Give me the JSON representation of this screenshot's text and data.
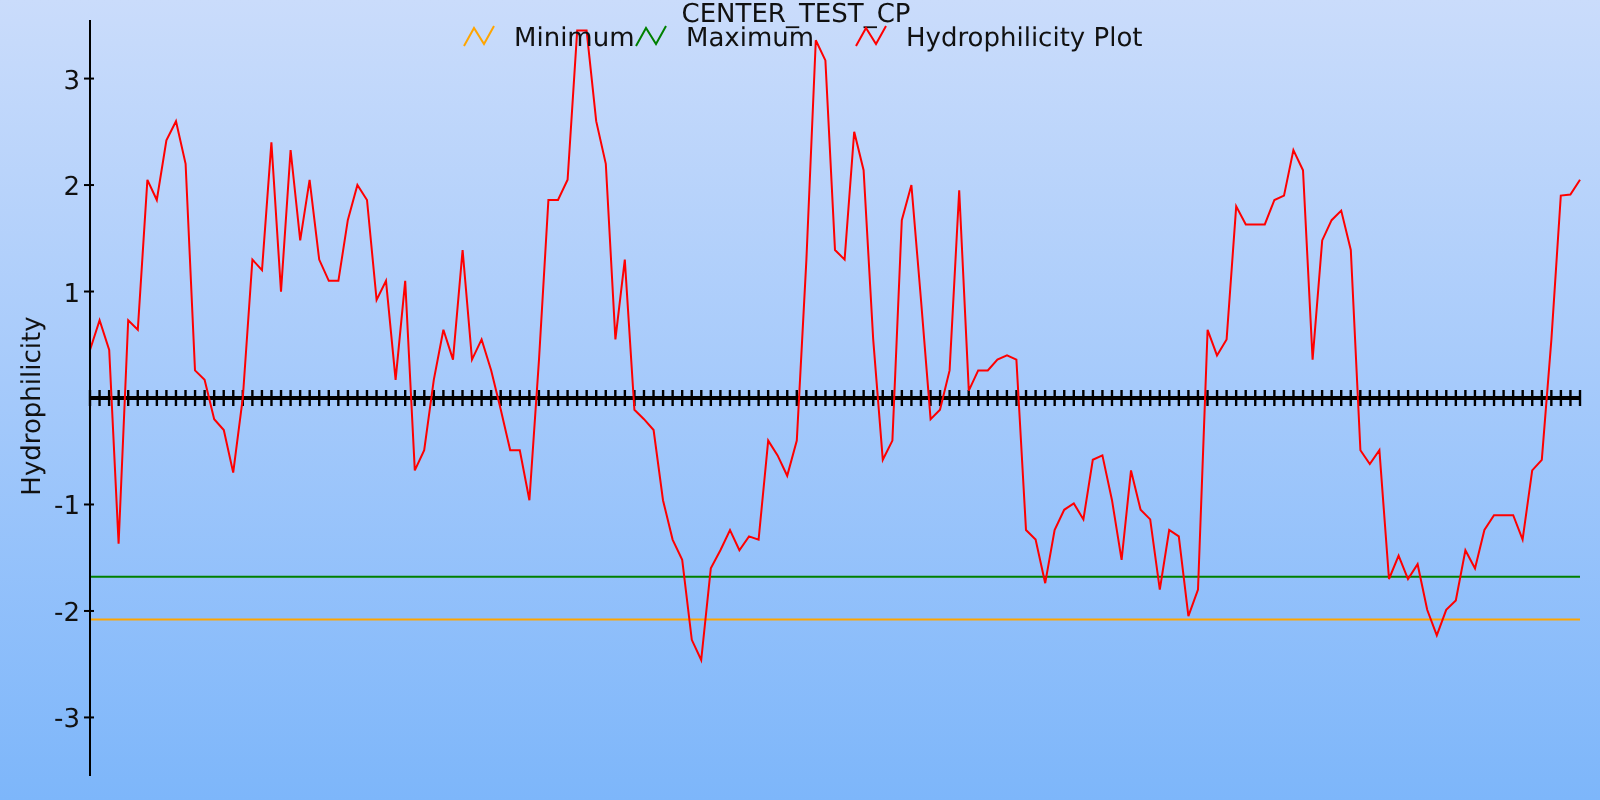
{
  "chart_data": {
    "type": "line",
    "title": "CENTER_TEST_CP",
    "ylabel": "Hydrophilicity",
    "legend": "top",
    "ylim": [
      -3.55,
      3.55
    ],
    "yticks": [
      -3,
      -2,
      -1,
      1,
      2,
      3
    ],
    "categories": [
      null,
      null,
      null,
      null,
      null,
      null,
      null,
      null,
      null,
      null,
      null,
      null,
      null,
      null,
      null,
      null,
      null,
      null,
      null,
      null,
      null,
      null,
      null,
      null,
      null,
      null,
      null,
      null,
      null,
      null,
      null,
      null,
      null,
      null,
      null,
      null,
      null,
      null,
      null,
      null,
      null,
      null,
      null,
      null,
      null,
      null,
      null,
      null,
      null,
      null,
      null,
      null,
      null,
      null,
      null,
      null,
      null,
      null,
      null,
      null,
      null,
      null,
      null,
      null,
      null,
      null,
      null,
      null,
      null,
      null,
      null,
      null,
      null,
      null,
      null,
      null,
      null,
      null,
      null,
      null,
      null,
      null,
      null,
      null,
      null,
      null,
      null,
      null,
      null,
      null,
      null,
      null,
      null,
      null,
      null,
      null,
      null,
      null,
      null,
      null,
      null,
      null,
      null,
      null,
      null,
      null,
      null,
      null,
      null,
      null,
      null,
      null,
      null,
      null,
      null,
      null,
      null,
      null,
      null,
      null,
      null,
      null,
      null,
      null,
      null,
      null,
      null,
      null,
      null,
      null,
      null,
      null,
      null,
      null,
      null,
      null,
      null,
      null,
      null,
      null,
      null,
      null,
      null,
      null,
      null,
      null,
      null,
      null,
      null,
      null,
      null,
      null,
      null,
      null,
      null,
      null,
      null
    ],
    "series": [
      {
        "name": "Minimum",
        "color": "#ffa500",
        "values": [
          -2.08,
          -2.08,
          -2.08,
          -2.08,
          -2.08,
          -2.08,
          -2.08,
          -2.08,
          -2.08,
          -2.08,
          -2.08,
          -2.08,
          -2.08,
          -2.08,
          -2.08,
          -2.08,
          -2.08,
          -2.08,
          -2.08,
          -2.08,
          -2.08,
          -2.08,
          -2.08,
          -2.08,
          -2.08,
          -2.08,
          -2.08,
          -2.08,
          -2.08,
          -2.08,
          -2.08,
          -2.08,
          -2.08,
          -2.08,
          -2.08,
          -2.08,
          -2.08,
          -2.08,
          -2.08,
          -2.08,
          -2.08,
          -2.08,
          -2.08,
          -2.08,
          -2.08,
          -2.08,
          -2.08,
          -2.08,
          -2.08,
          -2.08,
          -2.08,
          -2.08,
          -2.08,
          -2.08,
          -2.08,
          -2.08,
          -2.08,
          -2.08,
          -2.08,
          -2.08,
          -2.08,
          -2.08,
          -2.08,
          -2.08,
          -2.08,
          -2.08,
          -2.08,
          -2.08,
          -2.08,
          -2.08,
          -2.08,
          -2.08,
          -2.08,
          -2.08,
          -2.08,
          -2.08,
          -2.08,
          -2.08,
          -2.08,
          -2.08,
          -2.08,
          -2.08,
          -2.08,
          -2.08,
          -2.08,
          -2.08,
          -2.08,
          -2.08,
          -2.08,
          -2.08,
          -2.08,
          -2.08,
          -2.08,
          -2.08,
          -2.08,
          -2.08,
          -2.08,
          -2.08,
          -2.08,
          -2.08,
          -2.08,
          -2.08,
          -2.08,
          -2.08,
          -2.08,
          -2.08,
          -2.08,
          -2.08,
          -2.08,
          -2.08,
          -2.08,
          -2.08,
          -2.08,
          -2.08,
          -2.08,
          -2.08,
          -2.08,
          -2.08,
          -2.08,
          -2.08,
          -2.08,
          -2.08,
          -2.08,
          -2.08,
          -2.08,
          -2.08,
          -2.08,
          -2.08,
          -2.08,
          -2.08,
          -2.08,
          -2.08,
          -2.08,
          -2.08,
          -2.08,
          -2.08,
          -2.08,
          -2.08,
          -2.08,
          -2.08,
          -2.08,
          -2.08,
          -2.08,
          -2.08,
          -2.08,
          -2.08,
          -2.08,
          -2.08,
          -2.08,
          -2.08,
          -2.08,
          -2.08,
          -2.08,
          -2.08,
          -2.08,
          -2.08,
          -2.08
        ]
      },
      {
        "name": "Maximum",
        "color": "#008000",
        "values": [
          -1.68,
          -1.68,
          -1.68,
          -1.68,
          -1.68,
          -1.68,
          -1.68,
          -1.68,
          -1.68,
          -1.68,
          -1.68,
          -1.68,
          -1.68,
          -1.68,
          -1.68,
          -1.68,
          -1.68,
          -1.68,
          -1.68,
          -1.68,
          -1.68,
          -1.68,
          -1.68,
          -1.68,
          -1.68,
          -1.68,
          -1.68,
          -1.68,
          -1.68,
          -1.68,
          -1.68,
          -1.68,
          -1.68,
          -1.68,
          -1.68,
          -1.68,
          -1.68,
          -1.68,
          -1.68,
          -1.68,
          -1.68,
          -1.68,
          -1.68,
          -1.68,
          -1.68,
          -1.68,
          -1.68,
          -1.68,
          -1.68,
          -1.68,
          -1.68,
          -1.68,
          -1.68,
          -1.68,
          -1.68,
          -1.68,
          -1.68,
          -1.68,
          -1.68,
          -1.68,
          -1.68,
          -1.68,
          -1.68,
          -1.68,
          -1.68,
          -1.68,
          -1.68,
          -1.68,
          -1.68,
          -1.68,
          -1.68,
          -1.68,
          -1.68,
          -1.68,
          -1.68,
          -1.68,
          -1.68,
          -1.68,
          -1.68,
          -1.68,
          -1.68,
          -1.68,
          -1.68,
          -1.68,
          -1.68,
          -1.68,
          -1.68,
          -1.68,
          -1.68,
          -1.68,
          -1.68,
          -1.68,
          -1.68,
          -1.68,
          -1.68,
          -1.68,
          -1.68,
          -1.68,
          -1.68,
          -1.68,
          -1.68,
          -1.68,
          -1.68,
          -1.68,
          -1.68,
          -1.68,
          -1.68,
          -1.68,
          -1.68,
          -1.68,
          -1.68,
          -1.68,
          -1.68,
          -1.68,
          -1.68,
          -1.68,
          -1.68,
          -1.68,
          -1.68,
          -1.68,
          -1.68,
          -1.68,
          -1.68,
          -1.68,
          -1.68,
          -1.68,
          -1.68,
          -1.68,
          -1.68,
          -1.68,
          -1.68,
          -1.68,
          -1.68,
          -1.68,
          -1.68,
          -1.68,
          -1.68,
          -1.68,
          -1.68,
          -1.68,
          -1.68,
          -1.68,
          -1.68,
          -1.68,
          -1.68,
          -1.68,
          -1.68,
          -1.68,
          -1.68,
          -1.68,
          -1.68,
          -1.68,
          -1.68,
          -1.68,
          -1.68,
          -1.68,
          -1.68
        ]
      },
      {
        "name": "Hydrophilicity Plot",
        "color": "#ff0000",
        "values": [
          0.45,
          0.73,
          0.45,
          -1.37,
          0.73,
          0.64,
          2.05,
          1.86,
          2.42,
          2.6,
          2.2,
          0.26,
          0.17,
          -0.2,
          -0.3,
          -0.7,
          0,
          1.3,
          1.2,
          2.4,
          1.0,
          2.33,
          1.48,
          2.05,
          1.3,
          1.1,
          1.1,
          1.67,
          2.0,
          1.86,
          0.92,
          1.1,
          0.17,
          1.1,
          -0.68,
          -0.49,
          0.17,
          0.64,
          0.36,
          1.39,
          0.36,
          0.55,
          0.26,
          -0.11,
          -0.49,
          -0.49,
          -0.96,
          0.36,
          1.86,
          1.86,
          2.05,
          3.45,
          3.45,
          2.6,
          2.2,
          0.55,
          1.3,
          -0.11,
          -0.2,
          -0.3,
          -0.96,
          -1.33,
          -1.52,
          -2.27,
          -2.46,
          -1.6,
          -1.43,
          -1.24,
          -1.43,
          -1.3,
          -1.33,
          -0.4,
          -0.54,
          -0.73,
          -0.4,
          1.3,
          3.36,
          3.17,
          1.39,
          1.3,
          2.5,
          2.14,
          0.55,
          -0.58,
          -0.4,
          1.67,
          2.0,
          0.92,
          -0.2,
          -0.11,
          0.26,
          1.95,
          0.07,
          0.26,
          0.26,
          0.36,
          0.4,
          0.36,
          -1.24,
          -1.33,
          -1.74,
          -1.24,
          -1.05,
          -0.99,
          -1.14,
          -0.58,
          -0.54,
          -0.96,
          -1.52,
          -0.68,
          -1.05,
          -1.14,
          -1.8,
          -1.24,
          -1.3,
          -2.05,
          -1.8,
          0.64,
          0.4,
          0.55,
          1.8,
          1.63,
          1.63,
          1.63,
          1.86,
          1.9,
          2.33,
          2.14,
          0.36,
          1.48,
          1.67,
          1.76,
          1.39,
          -0.49,
          -0.62,
          -0.49,
          -1.7,
          -1.48,
          -1.7,
          -1.56,
          -1.99,
          -2.23,
          -1.99,
          -1.9,
          -1.43,
          -1.6,
          -1.24,
          -1.1,
          -1.1,
          -1.1,
          -1.33,
          -0.68,
          -0.58,
          0.55,
          1.9,
          1.91,
          2.05
        ]
      }
    ]
  }
}
